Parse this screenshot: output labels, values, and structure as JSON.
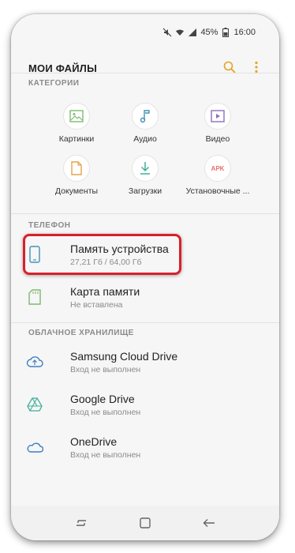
{
  "status_bar": {
    "battery": "45%",
    "time": "16:00"
  },
  "header": {
    "title": "МОИ ФАЙЛЫ",
    "search_icon": "search-icon",
    "more_icon": "more-vert-icon"
  },
  "sections": {
    "categories": "КАТЕГОРИИ",
    "phone": "ТЕЛЕФОН",
    "cloud": "ОБЛАЧНОЕ ХРАНИЛИЩЕ"
  },
  "categories": [
    {
      "label": "Картинки",
      "icon": "image-icon",
      "color": "#7dbb6e"
    },
    {
      "label": "Аудио",
      "icon": "music-note-icon",
      "color": "#3f93b8"
    },
    {
      "label": "Видео",
      "icon": "video-icon",
      "color": "#8a6fc0"
    },
    {
      "label": "Документы",
      "icon": "document-icon",
      "color": "#e6a24b"
    },
    {
      "label": "Загрузки",
      "icon": "download-icon",
      "color": "#3faf9c"
    },
    {
      "label": "Установочные ...",
      "icon": "apk-icon",
      "icon_text": "APK",
      "color": "#e87070"
    }
  ],
  "phone_items": [
    {
      "title": "Память устройства",
      "subtitle": "27,21 Гб / 64,00 Гб",
      "icon": "phone-storage-icon"
    },
    {
      "title": "Карта памяти",
      "subtitle": "Не вставлена",
      "icon": "sd-card-icon"
    }
  ],
  "cloud_items": [
    {
      "title": "Samsung Cloud Drive",
      "subtitle": "Вход не выполнен",
      "icon": "samsung-cloud-icon"
    },
    {
      "title": "Google Drive",
      "subtitle": "Вход не выполнен",
      "icon": "google-drive-icon"
    },
    {
      "title": "OneDrive",
      "subtitle": "Вход не выполнен",
      "icon": "onedrive-icon"
    }
  ],
  "colors": {
    "highlight": "#d8202a",
    "accent": "#e6a324"
  }
}
